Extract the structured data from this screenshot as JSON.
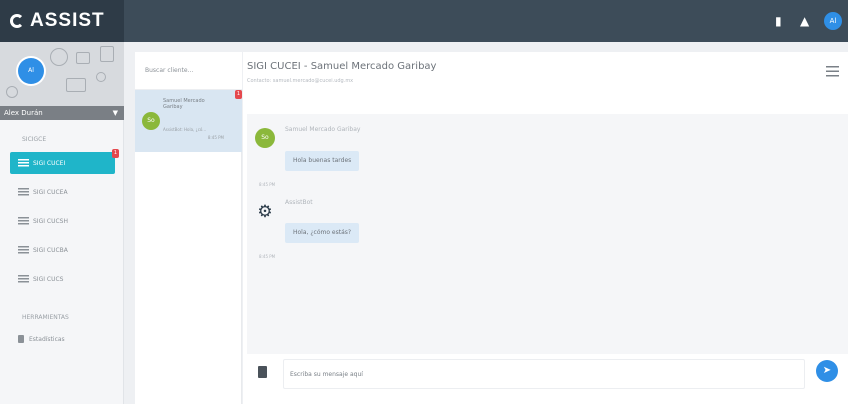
{
  "header": {
    "brand": "ASSIST",
    "avatar_initials": "Al",
    "icons": [
      "bookmark-icon",
      "bell-icon"
    ]
  },
  "sidebar": {
    "user": {
      "initials": "Al",
      "name": "Alex Durán"
    },
    "section_label": "SICIGCE",
    "items": [
      {
        "label": "SIGI CUCEI",
        "active": true,
        "badge": "1"
      },
      {
        "label": "SIGI CUCEA",
        "active": false
      },
      {
        "label": "SIGI CUCSH",
        "active": false
      },
      {
        "label": "SIGI CUCBA",
        "active": false
      },
      {
        "label": "SIGI CUCS",
        "active": false
      }
    ],
    "tools_label": "HERRAMIENTAS",
    "tools": [
      {
        "label": "Estadísticas"
      }
    ]
  },
  "conversations": {
    "search_placeholder": "Buscar cliente...",
    "items": [
      {
        "initials": "So",
        "name": "Samuel Mercado Garibay",
        "preview": "AssistBot: Hola, ¿có...",
        "time": "8:45 PM",
        "badge": "1"
      }
    ]
  },
  "chat": {
    "title": "SIGI CUCEI - Samuel Mercado Garibay",
    "subtitle": "Contacto: samuel.mercado@cucei.udg.mx",
    "messages": [
      {
        "sender": "Samuel Mercado Garibay",
        "initials": "So",
        "text": "Hola buenas tardes",
        "time": "8:45 PM"
      },
      {
        "sender": "AssistBot",
        "text": "Hola, ¿cómo estás?",
        "time": "8:45 PM"
      }
    ],
    "input_placeholder": "Escriba su mensaje aquí",
    "send_icon": "paper-plane-icon"
  },
  "colors": {
    "topbar": "#3d4c59",
    "accent_teal": "#1fb5c9",
    "accent_blue": "#2f8fe6",
    "badge_red": "#e5484d",
    "bubble": "#dbe9f6"
  }
}
